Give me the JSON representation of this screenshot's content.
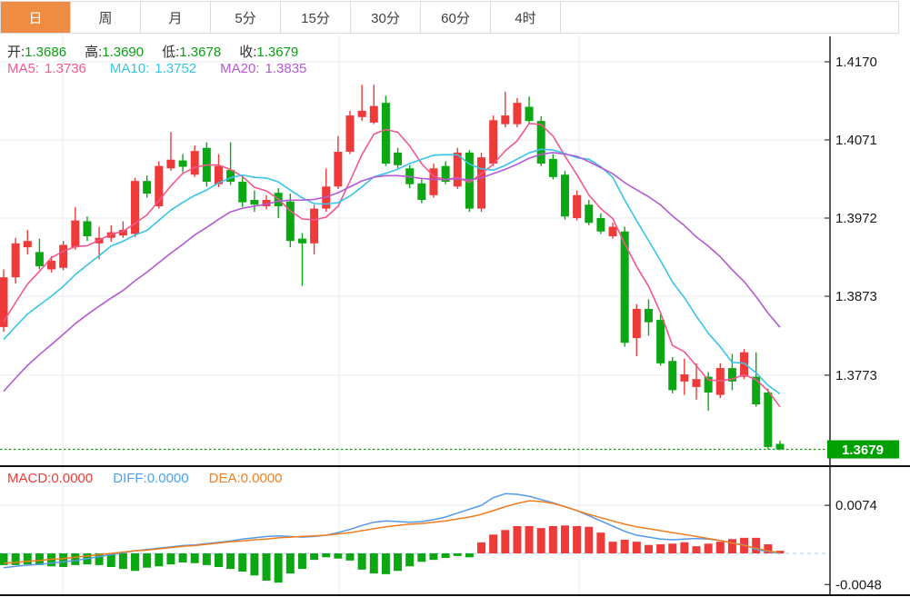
{
  "tabs": {
    "items": [
      {
        "id": "day",
        "label": "日",
        "active": true
      },
      {
        "id": "week",
        "label": "周",
        "active": false
      },
      {
        "id": "month",
        "label": "月",
        "active": false
      },
      {
        "id": "5min",
        "label": "5分",
        "active": false
      },
      {
        "id": "15min",
        "label": "15分",
        "active": false
      },
      {
        "id": "30min",
        "label": "30分",
        "active": false
      },
      {
        "id": "60min",
        "label": "60分",
        "active": false
      },
      {
        "id": "4hour",
        "label": "4时",
        "active": false
      }
    ]
  },
  "main_header": {
    "open_label": "开:",
    "open": "1.3686",
    "high_label": "高:",
    "high": "1.3690",
    "low_label": "低:",
    "low": "1.3678",
    "close_label": "收:",
    "close": "1.3679",
    "ma5_label": "MA5:",
    "ma5": "1.3736",
    "ma10_label": "MA10:",
    "ma10": "1.3752",
    "ma20_label": "MA20:",
    "ma20": "1.3835"
  },
  "macd_header": {
    "macd_label": "MACD:",
    "macd": "0.0000",
    "diff_label": "DIFF:",
    "diff": "0.0000",
    "dea_label": "DEA:",
    "dea": "0.0000"
  },
  "colors": {
    "up": "#ef3a3a",
    "down": "#0ca814",
    "ma5": "#f2588e",
    "ma10": "#38c4e8",
    "ma20": "#b35ad2",
    "diff_line": "#5599e8",
    "dea_line": "#ef7d1f",
    "badge": "#00a000",
    "accent_tab": "#ee8c44",
    "grid": "#e9ebf2",
    "axis": "#222222",
    "zero_dash": "#a5d2f0",
    "price_dotted": "#0aa00a",
    "label_text": "#1a1a1a"
  },
  "chart_data": {
    "type": "candlestick",
    "title": "",
    "price_ticks": [
      "1.4170",
      "1.4071",
      "1.3972",
      "1.3873",
      "1.3773"
    ],
    "current_price": "1.3679",
    "macd_ticks": [
      "0.0074",
      "-0.0048"
    ],
    "ma_periods": [
      5,
      10,
      20
    ],
    "ma_seed_closes": [
      1.359,
      1.3605,
      1.362,
      1.364,
      1.366,
      1.368,
      1.37,
      1.3718,
      1.3735,
      1.375,
      1.3762,
      1.3774,
      1.3786,
      1.3796,
      1.3806,
      1.3814,
      1.382,
      1.3826,
      1.383,
      1.3832
    ],
    "candles": [
      [
        1.3834,
        1.3907,
        1.3828,
        1.3897
      ],
      [
        1.3897,
        1.3947,
        1.3889,
        1.394
      ],
      [
        1.3935,
        1.3957,
        1.3926,
        1.3943
      ],
      [
        1.3929,
        1.3946,
        1.3907,
        1.3911
      ],
      [
        1.3907,
        1.3924,
        1.3903,
        1.3918
      ],
      [
        1.3909,
        1.3943,
        1.3906,
        1.3938
      ],
      [
        1.3935,
        1.3986,
        1.3932,
        1.3969
      ],
      [
        1.3968,
        1.3974,
        1.3943,
        1.3949
      ],
      [
        1.394,
        1.3961,
        1.392,
        1.3947
      ],
      [
        1.3947,
        1.3963,
        1.3942,
        1.3954
      ],
      [
        1.395,
        1.3968,
        1.3947,
        1.3957
      ],
      [
        1.3952,
        1.4023,
        1.3948,
        1.4019
      ],
      [
        1.4019,
        1.4026,
        1.3998,
        1.4003
      ],
      [
        1.3987,
        1.4044,
        1.3984,
        1.4038
      ],
      [
        1.4035,
        1.4081,
        1.4032,
        1.4046
      ],
      [
        1.4045,
        1.4053,
        1.403,
        1.4037
      ],
      [
        1.4027,
        1.4064,
        1.4024,
        1.4057
      ],
      [
        1.4061,
        1.4068,
        1.4012,
        1.4018
      ],
      [
        1.4015,
        1.4053,
        1.4011,
        1.4038
      ],
      [
        1.4033,
        1.4068,
        1.4014,
        1.4018
      ],
      [
        1.4018,
        1.4024,
        1.3986,
        1.3992
      ],
      [
        1.3995,
        1.4007,
        1.398,
        1.3989
      ],
      [
        1.3987,
        1.4001,
        1.3983,
        1.3995
      ],
      [
        1.4004,
        1.401,
        1.3972,
        1.3987
      ],
      [
        1.3993,
        1.4003,
        1.3935,
        1.3943
      ],
      [
        1.3946,
        1.3953,
        1.3886,
        1.394
      ],
      [
        1.394,
        1.3989,
        1.3926,
        1.3984
      ],
      [
        1.3984,
        1.4035,
        1.398,
        1.4012
      ],
      [
        1.4012,
        1.4076,
        1.4009,
        1.4056
      ],
      [
        1.4056,
        1.4108,
        1.4053,
        1.4102
      ],
      [
        1.41,
        1.4141,
        1.4095,
        1.4108
      ],
      [
        1.4093,
        1.4141,
        1.4091,
        1.4114
      ],
      [
        1.4118,
        1.4127,
        1.4038,
        1.4041
      ],
      [
        1.4055,
        1.4061,
        1.4035,
        1.4039
      ],
      [
        1.4035,
        1.4039,
        1.401,
        1.4015
      ],
      [
        1.4016,
        1.4021,
        1.3991,
        1.3995
      ],
      [
        1.4001,
        1.4041,
        1.3998,
        1.4035
      ],
      [
        1.4038,
        1.4044,
        1.4015,
        1.4018
      ],
      [
        1.4012,
        1.4061,
        1.4009,
        1.4055
      ],
      [
        1.4055,
        1.4058,
        1.398,
        1.3984
      ],
      [
        1.3984,
        1.4055,
        1.398,
        1.4049
      ],
      [
        1.4041,
        1.4102,
        1.4038,
        1.4096
      ],
      [
        1.4091,
        1.4132,
        1.4087,
        1.4102
      ],
      [
        1.4091,
        1.4124,
        1.4087,
        1.4118
      ],
      [
        1.4113,
        1.4126,
        1.4092,
        1.4095
      ],
      [
        1.4095,
        1.4101,
        1.4038,
        1.4041
      ],
      [
        1.4047,
        1.4053,
        1.4021,
        1.4024
      ],
      [
        1.4027,
        1.4032,
        1.397,
        1.3974
      ],
      [
        1.3972,
        1.4007,
        1.3969,
        1.4001
      ],
      [
        1.3989,
        1.3995,
        1.3963,
        1.3966
      ],
      [
        1.3972,
        1.3978,
        1.3952,
        1.3955
      ],
      [
        1.3949,
        1.3966,
        1.3946,
        1.3961
      ],
      [
        1.3955,
        1.3961,
        1.3809,
        1.3814
      ],
      [
        1.382,
        1.3863,
        1.3797,
        1.3857
      ],
      [
        1.3857,
        1.3869,
        1.3823,
        1.384
      ],
      [
        1.3843,
        1.3851,
        1.3785,
        1.3788
      ],
      [
        1.3791,
        1.3796,
        1.375,
        1.3754
      ],
      [
        1.3765,
        1.3794,
        1.3748,
        1.3774
      ],
      [
        1.3758,
        1.3788,
        1.3742,
        1.3768
      ],
      [
        1.3771,
        1.3777,
        1.3728,
        1.3751
      ],
      [
        1.3748,
        1.3788,
        1.3744,
        1.3782
      ],
      [
        1.3782,
        1.38,
        1.3754,
        1.3765
      ],
      [
        1.3771,
        1.3806,
        1.3768,
        1.3802
      ],
      [
        1.3771,
        1.3802,
        1.3733,
        1.3736
      ],
      [
        1.3751,
        1.3756,
        1.3679,
        1.3682
      ],
      [
        1.3686,
        1.369,
        1.3678,
        1.3679
      ]
    ],
    "macd": {
      "hist": [
        -0.0018,
        -0.0018,
        -0.0017,
        -0.0018,
        -0.002,
        -0.0021,
        -0.0018,
        -0.0017,
        -0.0018,
        -0.0021,
        -0.0024,
        -0.0027,
        -0.0022,
        -0.002,
        -0.0017,
        -0.0014,
        -0.0015,
        -0.0018,
        -0.0021,
        -0.0024,
        -0.0028,
        -0.0034,
        -0.0042,
        -0.0045,
        -0.0031,
        -0.0024,
        -0.001,
        -0.0006,
        -0.0008,
        -0.0011,
        -0.0025,
        -0.0031,
        -0.0032,
        -0.0027,
        -0.002,
        -0.0013,
        -0.001,
        -0.0007,
        -0.0004,
        -0.0006,
        0.0017,
        0.0029,
        0.0036,
        0.0042,
        0.0042,
        0.0039,
        0.0042,
        0.0043,
        0.0042,
        0.0041,
        0.0032,
        0.0018,
        0.0021,
        0.0018,
        0.0013,
        0.0014,
        0.0015,
        0.0017,
        0.0011,
        0.0015,
        0.0018,
        0.0022,
        0.0024,
        0.0024,
        0.0014,
        0.0004
      ],
      "diff": [
        -0.0022,
        -0.002,
        -0.0018,
        -0.0017,
        -0.0015,
        -0.0013,
        -0.0011,
        -0.0008,
        -0.0005,
        -0.0002,
        0.0001,
        0.0004,
        0.0006,
        0.0008,
        0.001,
        0.0012,
        0.0013,
        0.0015,
        0.0017,
        0.0019,
        0.0022,
        0.0024,
        0.0026,
        0.0027,
        0.0026,
        0.0025,
        0.0026,
        0.0028,
        0.0032,
        0.0037,
        0.0043,
        0.0048,
        0.005,
        0.0049,
        0.0048,
        0.0049,
        0.0052,
        0.0056,
        0.0062,
        0.0068,
        0.0074,
        0.0086,
        0.0092,
        0.0091,
        0.0088,
        0.0083,
        0.0078,
        0.0072,
        0.0066,
        0.0058,
        0.005,
        0.0042,
        0.0034,
        0.0028,
        0.0025,
        0.0022,
        0.0021,
        0.0022,
        0.0023,
        0.0022,
        0.002,
        0.0016,
        0.0013,
        0.0006,
        0.0003,
        0.0
      ],
      "dea": [
        -0.0015,
        -0.0014,
        -0.0012,
        -0.0011,
        -0.0009,
        -0.0008,
        -0.0006,
        -0.0004,
        -0.0002,
        0.0,
        0.0002,
        0.0004,
        0.0005,
        0.0007,
        0.0009,
        0.0011,
        0.0012,
        0.0014,
        0.0016,
        0.0018,
        0.0019,
        0.0021,
        0.0022,
        0.0024,
        0.0025,
        0.0026,
        0.0027,
        0.0028,
        0.003,
        0.0032,
        0.0035,
        0.0038,
        0.0041,
        0.0043,
        0.0045,
        0.0046,
        0.0048,
        0.005,
        0.0053,
        0.0056,
        0.006,
        0.0066,
        0.0072,
        0.0077,
        0.0081,
        0.008,
        0.0077,
        0.0072,
        0.0066,
        0.006,
        0.0055,
        0.005,
        0.0045,
        0.0041,
        0.0038,
        0.0035,
        0.0032,
        0.0029,
        0.0026,
        0.0023,
        0.002,
        0.0016,
        0.0012,
        0.0008,
        0.0004,
        0.0001
      ]
    },
    "layout_hints": {
      "grid": true,
      "price_axis_side": "right",
      "panels": [
        "price_candles_with_ma",
        "macd_histogram_with_diff_dea"
      ]
    }
  }
}
